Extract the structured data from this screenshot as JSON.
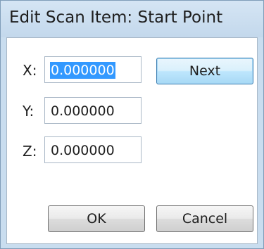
{
  "dialog": {
    "title": "Edit Scan Item: Start Point"
  },
  "fields": [
    {
      "label": "X:",
      "value": "0.000000",
      "selected": true
    },
    {
      "label": "Y:",
      "value": "0.000000",
      "selected": false
    },
    {
      "label": "Z:",
      "value": "0.000000",
      "selected": false
    }
  ],
  "buttons": {
    "next": "Next",
    "ok": "OK",
    "cancel": "Cancel"
  }
}
